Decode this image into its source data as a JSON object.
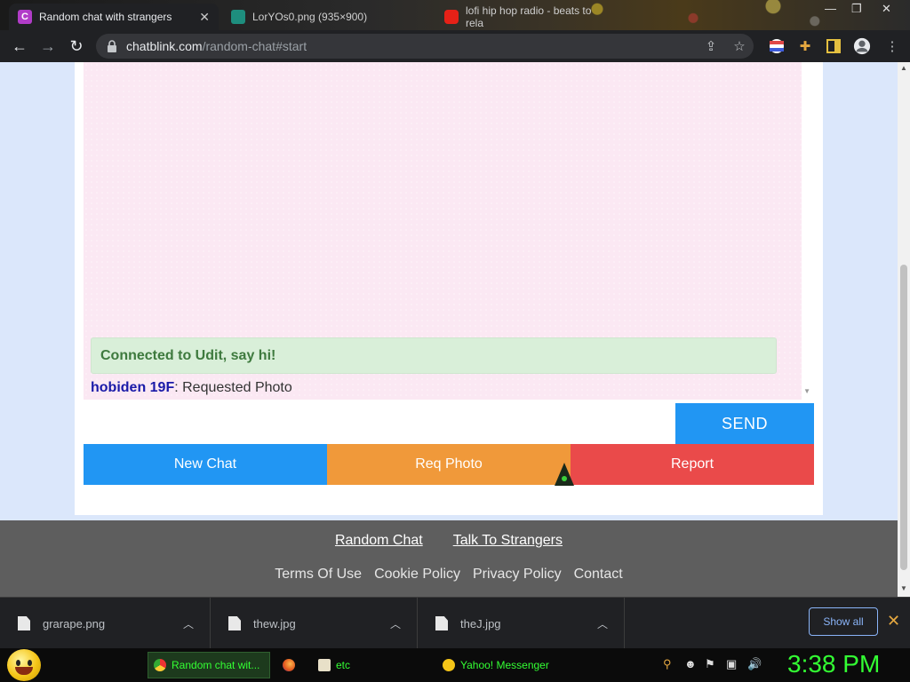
{
  "tabs": [
    {
      "title": "Random chat with strangers",
      "favicon": "C",
      "active": true
    },
    {
      "title": "LorYOs0.png (935×900)",
      "favicon": "",
      "active": false
    },
    {
      "title": "lofi hip hop radio - beats to rela",
      "favicon": "",
      "active": false
    }
  ],
  "address": {
    "host": "chatblink.com",
    "path": "/random-chat#start"
  },
  "chat": {
    "system_message": "Connected to Udit, say hi!",
    "lines": [
      {
        "nick": "hobiden 19F",
        "sep": ": ",
        "text": "Requested Photo"
      }
    ]
  },
  "controls": {
    "send_label": "SEND",
    "new_chat_label": "New Chat",
    "req_photo_label": "Req Photo",
    "report_label": "Report"
  },
  "footer": {
    "primary_links": [
      "Random Chat",
      "Talk To Strangers"
    ],
    "secondary_links": [
      "Terms Of Use",
      "Cookie Policy",
      "Privacy Policy",
      "Contact"
    ]
  },
  "downloads": {
    "items": [
      "grarape.png",
      "thew.jpg",
      "theJ.jpg"
    ],
    "show_all_label": "Show all"
  },
  "taskbar": {
    "tasks": [
      "Random chat wit...",
      "",
      "etc",
      "Yahoo! Messenger"
    ],
    "clock": "3:38 PM"
  },
  "colors": {
    "send": "#2196f3",
    "new_chat": "#2196f3",
    "req_photo": "#f0993a",
    "report": "#ea4a4a",
    "system_message_bg": "#d9efd9",
    "chat_bg": "#fbe8f3",
    "nick": "#1a1aa8",
    "taskbar_text": "#33ff33"
  }
}
